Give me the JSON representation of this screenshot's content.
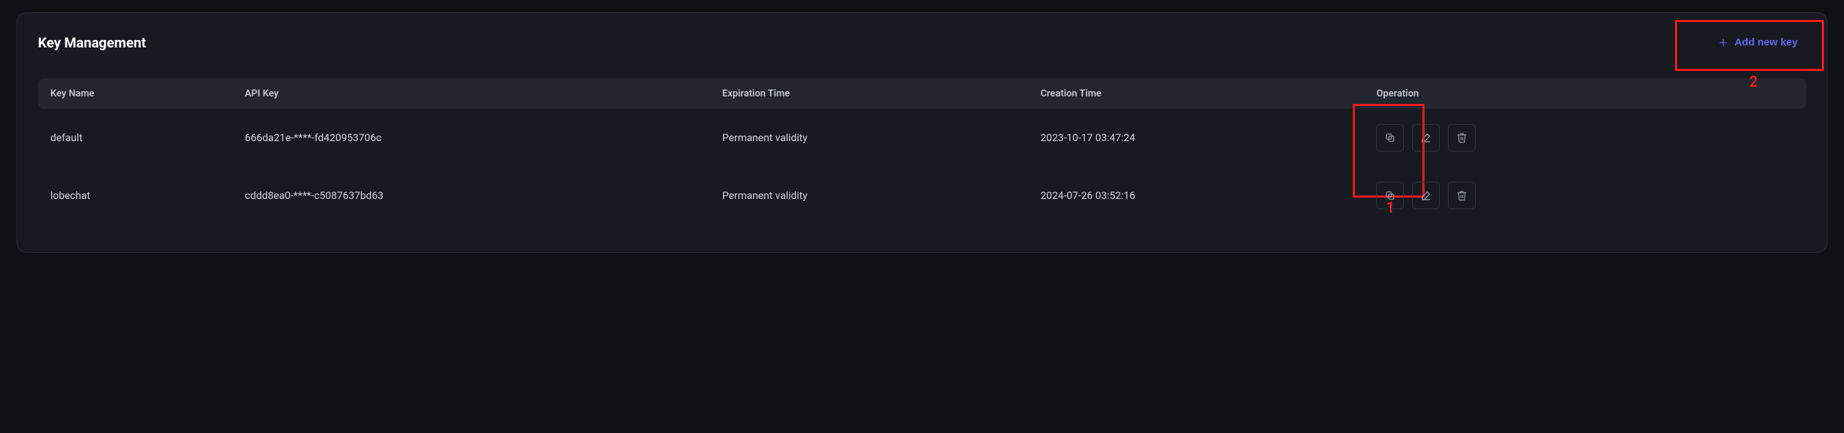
{
  "panel": {
    "title": "Key Management",
    "add_label": "Add new key"
  },
  "table": {
    "headers": {
      "name": "Key Name",
      "api": "API Key",
      "expiration": "Expiration Time",
      "creation": "Creation Time",
      "operation": "Operation"
    },
    "rows": [
      {
        "name": "default",
        "api_key": "666da21e-****-fd420953706c",
        "expiration": "Permanent validity",
        "creation": "2023-10-17 03:47:24"
      },
      {
        "name": "lobechat",
        "api_key": "cddd8ea0-****-c5087637bd63",
        "expiration": "Permanent validity",
        "creation": "2024-07-26 03:52:16"
      }
    ]
  },
  "annotations": {
    "copy": "1",
    "add": "2"
  }
}
